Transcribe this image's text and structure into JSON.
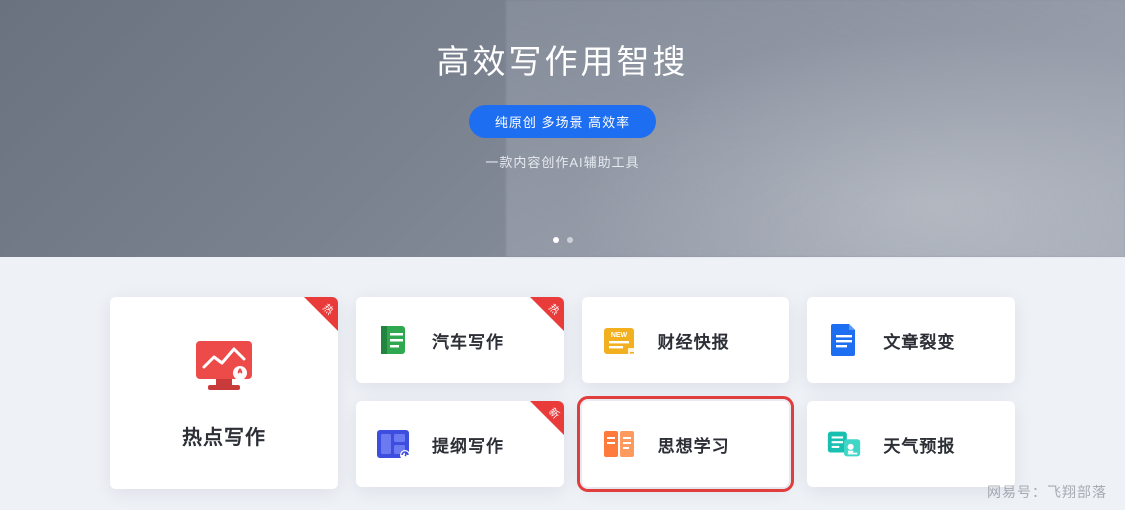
{
  "hero": {
    "title": "高效写作用智搜",
    "pill": "纯原创 多场景 高效率",
    "subtitle": "一款内容创作AI辅助工具"
  },
  "feature": {
    "label": "热点写作",
    "badge": "热",
    "icon": "chart-screen-icon",
    "color": "#ed4a4a"
  },
  "cards": [
    {
      "label": "汽车写作",
      "badge": "热",
      "icon": "book-icon",
      "color": "#2fa84f"
    },
    {
      "label": "财经快报",
      "badge": "",
      "icon": "news-icon",
      "color": "#f2b020"
    },
    {
      "label": "文章裂变",
      "badge": "",
      "icon": "doc-icon",
      "color": "#1d6ef0"
    },
    {
      "label": "提纲写作",
      "badge": "新",
      "icon": "layout-icon",
      "color": "#3c4de0"
    },
    {
      "label": "思想学习",
      "badge": "",
      "icon": "study-icon",
      "color": "#ff7a3d",
      "highlight": true
    },
    {
      "label": "天气预报",
      "badge": "",
      "icon": "weather-icon",
      "color": "#17c0b0"
    }
  ],
  "watermark": "网易号：飞翔部落"
}
